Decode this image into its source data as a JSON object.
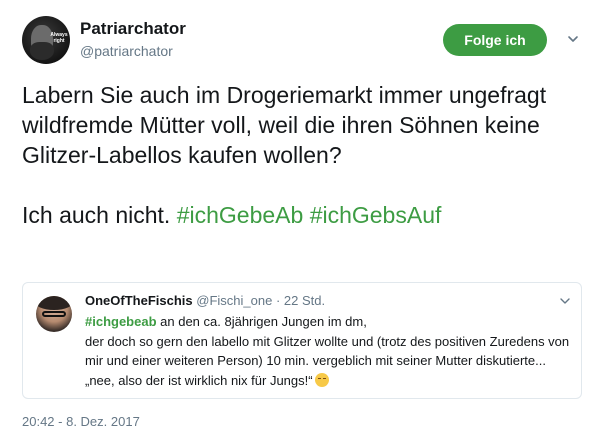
{
  "author": {
    "name": "Patriarchator",
    "handle": "@patriarchator",
    "avatar_text": "Always right"
  },
  "follow_button": "Folge ich",
  "tweet": {
    "line1": "Labern Sie auch im Drogeriemarkt immer ungefragt wildfremde Mütter voll, weil die ihren Söhnen keine Glitzer-Labellos kaufen wollen?",
    "line2_text": "Ich auch nicht. ",
    "hashtag1": "#ichGebeAb",
    "hashtag2": "#ichGebsAuf"
  },
  "quoted": {
    "name": "OneOfTheFischis",
    "handle": "@Fischi_one",
    "separator": " · ",
    "time": "22 Std.",
    "hashtag": "#ichgebeab",
    "text_first": " an den ca. 8jährigen Jungen im dm,",
    "text_rest": "der doch so gern den labello mit Glitzer wollte und (trotz des positiven Zuredens von mir und einer weiteren Person) 10 min. vergeblich mit seiner Mutter diskutierte...„nee, also der ist wirklich nix für Jungs!“",
    "emoji": "relieved-face-emoji"
  },
  "timestamp": "20:42 - 8. Dez. 2017",
  "colors": {
    "accent_green": "#3d9c43",
    "secondary_text": "#657786",
    "border": "#e1e8ed"
  },
  "icons": {
    "menu": "chevron-down-icon"
  }
}
